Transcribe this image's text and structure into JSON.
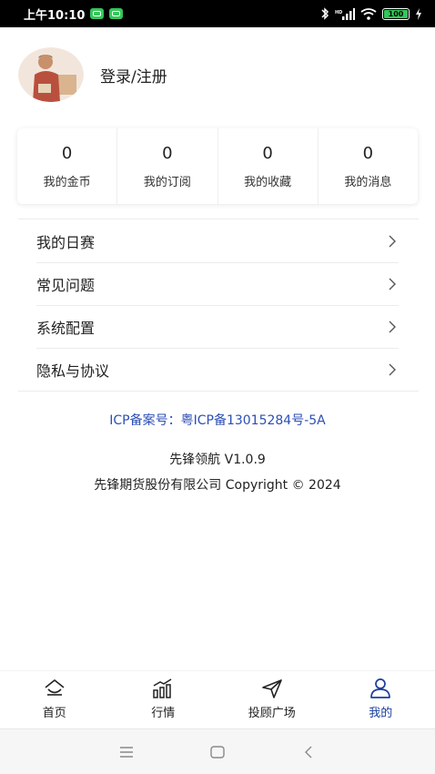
{
  "status_bar": {
    "time": "上午10:10",
    "battery": "100"
  },
  "profile": {
    "login_label": "登录/注册"
  },
  "stats": [
    {
      "value": "0",
      "label": "我的金币"
    },
    {
      "value": "0",
      "label": "我的订阅"
    },
    {
      "value": "0",
      "label": "我的收藏"
    },
    {
      "value": "0",
      "label": "我的消息"
    }
  ],
  "menu": [
    {
      "label": "我的日赛"
    },
    {
      "label": "常见问题"
    },
    {
      "label": "系统配置"
    },
    {
      "label": "隐私与协议"
    }
  ],
  "footer": {
    "icp": "ICP备案号：粤ICP备13015284号-5A",
    "version": "先锋领航 V1.0.9",
    "copyright": "先锋期货股份有限公司 Copyright © 2024"
  },
  "tabs": [
    {
      "label": "首页",
      "icon": "home-icon"
    },
    {
      "label": "行情",
      "icon": "market-chart-icon"
    },
    {
      "label": "投顾广场",
      "icon": "send-arrow-icon"
    },
    {
      "label": "我的",
      "icon": "user-icon",
      "active": true
    }
  ],
  "colors": {
    "accent": "#1b3f9c",
    "icp_link": "#2d4fb5",
    "battery": "#34c759"
  }
}
